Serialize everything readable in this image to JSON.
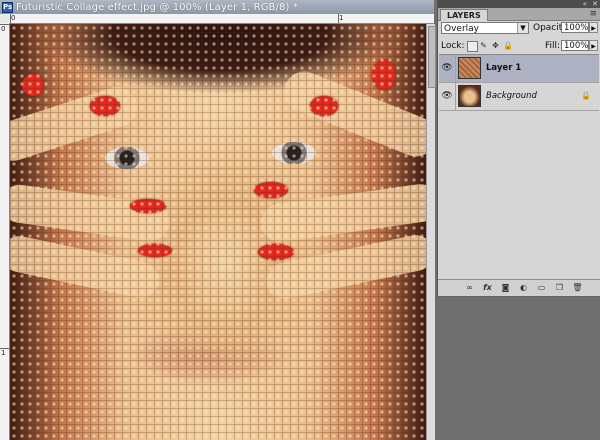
{
  "document": {
    "title": "Futuristic Collage effect.jpg @ 100% (Layer 1, RGB/8) *",
    "ruler_top_labels": [
      "0",
      "1"
    ],
    "ruler_left_labels": [
      "0",
      "1"
    ]
  },
  "layers_panel": {
    "tab_label": "LAYERS",
    "blend_mode": "Overlay",
    "opacity_label": "Opacity:",
    "opacity_value": "100%",
    "lock_label": "Lock:",
    "fill_label": "Fill:",
    "fill_value": "100%",
    "layers": [
      {
        "name": "Layer 1",
        "selected": true,
        "visible": true,
        "locked": false
      },
      {
        "name": "Background",
        "selected": false,
        "visible": true,
        "locked": true
      }
    ],
    "footer_icons": [
      "link-icon",
      "fx-icon",
      "mask-icon",
      "adjustment-icon",
      "folder-icon",
      "new-layer-icon",
      "trash-icon"
    ]
  },
  "colors": {
    "selected_layer": "#aeb1c2",
    "title_bar": "#9aa3b2",
    "nail_red": "#e8261b"
  }
}
